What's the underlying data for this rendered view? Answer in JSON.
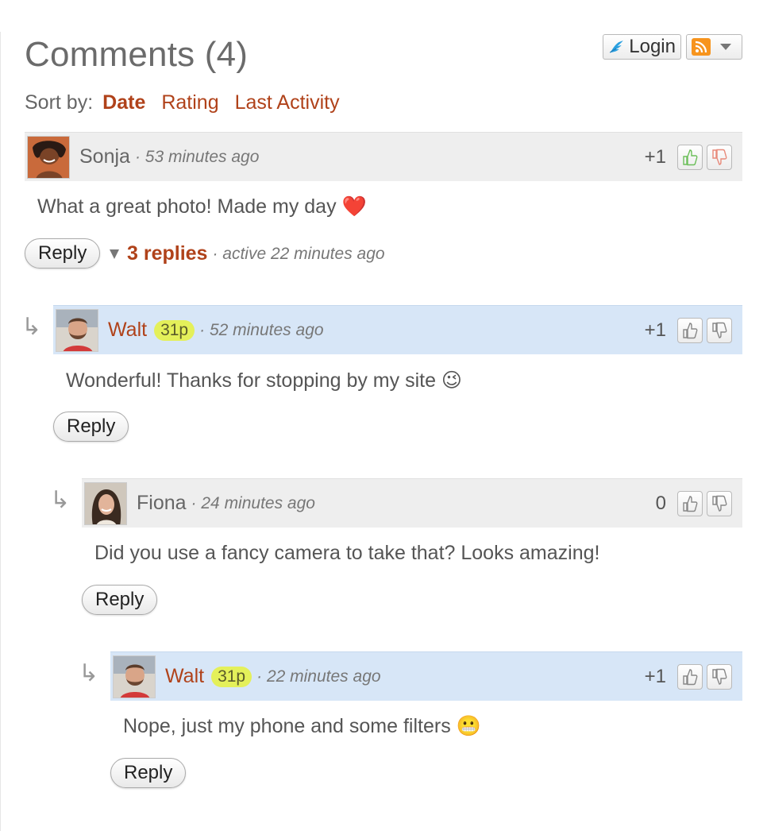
{
  "header": {
    "title": "Comments (4)",
    "login_label": "Login"
  },
  "sort": {
    "label": "Sort by:",
    "options": [
      "Date",
      "Rating",
      "Last Activity"
    ],
    "active": "Date"
  },
  "comments": [
    {
      "author": "Sonja",
      "owner": false,
      "time": "53 minutes ago",
      "score": "+1",
      "text": "What a great photo! Made my day ❤️",
      "reply_label": "Reply",
      "replies_label": "3 replies",
      "active_text": "active 22 minutes ago"
    },
    {
      "author": "Walt",
      "owner": true,
      "points": "31p",
      "time": "52 minutes ago",
      "score": "+1",
      "text": "Wonderful! Thanks for stopping by my site 😉",
      "reply_label": "Reply"
    },
    {
      "author": "Fiona",
      "owner": false,
      "time": "24 minutes ago",
      "score": "0",
      "text": "Did you use a fancy camera to take that? Looks amazing!",
      "reply_label": "Reply"
    },
    {
      "author": "Walt",
      "owner": true,
      "points": "31p",
      "time": "22 minutes ago",
      "score": "+1",
      "text": "Nope, just my phone and some filters 😬",
      "reply_label": "Reply"
    }
  ],
  "colors": {
    "accent": "#b0421a",
    "owner_header": "#d7e6f7",
    "header": "#eeeeee",
    "points_badge": "#e4f05a"
  },
  "icons": [
    "wing-icon",
    "rss-icon",
    "chevron-down-icon",
    "thumbs-up-icon",
    "thumbs-down-icon",
    "reply-arrow-icon"
  ]
}
